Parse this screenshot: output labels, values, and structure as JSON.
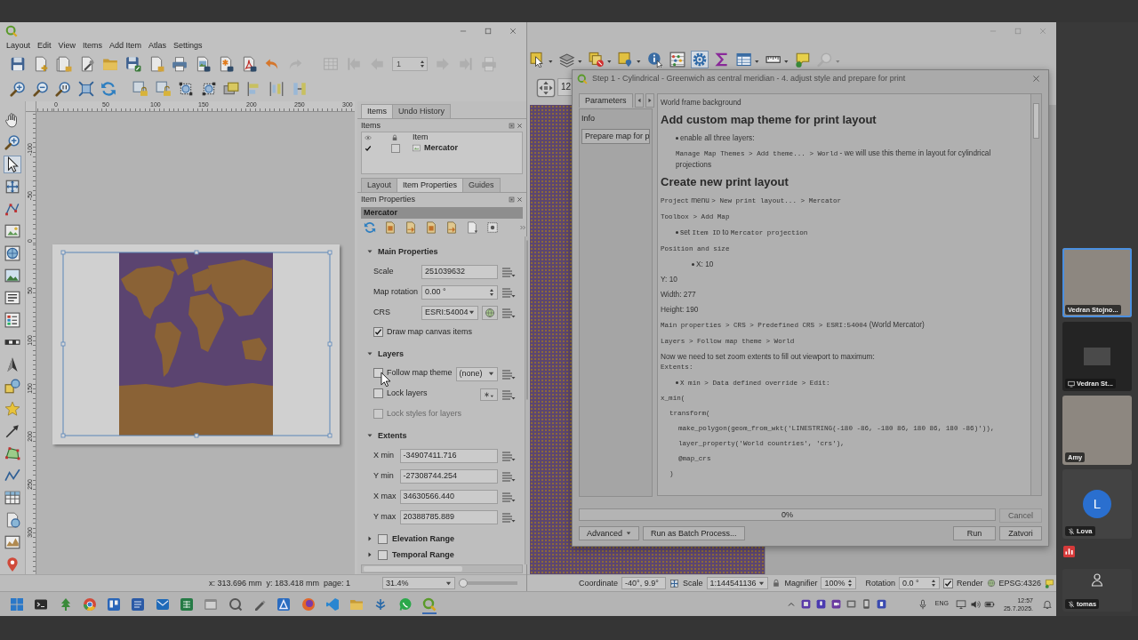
{
  "layout_window": {
    "menu": [
      "Layout",
      "Edit",
      "View",
      "Items",
      "Add Item",
      "Atlas",
      "Settings"
    ],
    "toolbar": [
      {
        "disabled": false
      },
      {
        "disabled": false
      },
      {
        "disabled": false
      },
      {
        "disabled": false
      },
      {
        "disabled": false
      },
      {
        "disabled": false
      },
      {
        "disabled": false
      },
      {
        "disabled": false
      },
      {
        "disabled": false
      },
      {
        "disabled": false
      },
      {
        "disabled": false
      },
      {
        "disabled": false
      },
      {
        "disabled": true
      }
    ],
    "atlas_toolbar": [
      {
        "kind": "button",
        "disabled": true
      },
      {
        "kind": "button",
        "disabled": true
      },
      {
        "kind": "button",
        "disabled": true
      },
      {
        "kind": "field",
        "value": "1",
        "disabled": true
      },
      {
        "kind": "button",
        "disabled": true
      },
      {
        "kind": "button",
        "disabled": true
      },
      {
        "kind": "button",
        "disabled": true
      }
    ],
    "toolbox": [
      {
        "selected": false
      },
      {
        "selected": false
      },
      {
        "selected": true
      },
      {
        "selected": false
      },
      {
        "selected": false
      },
      {
        "selected": false
      },
      {
        "selected": false
      },
      {
        "selected": false
      },
      {
        "selected": false
      },
      {
        "selected": false
      },
      {
        "selected": false
      },
      {
        "selected": false
      },
      {
        "selected": false
      },
      {
        "selected": false
      },
      {
        "selected": false
      },
      {
        "selected": false
      },
      {
        "selected": false
      },
      {
        "selected": false
      },
      {
        "selected": false
      },
      {
        "selected": false
      },
      {
        "selected": false
      }
    ],
    "ruler_labels": [
      "0",
      "50",
      "100",
      "150",
      "200",
      "250",
      "300"
    ],
    "vertical_ruler_labels": [
      "-100",
      "-50",
      "0",
      "50",
      "100",
      "150",
      "200",
      "250",
      "300"
    ],
    "items_dock": {
      "tabs": [
        {
          "label": "Items",
          "selected": true
        },
        {
          "label": "Undo History",
          "selected": false
        }
      ],
      "title": "Items",
      "column": "Item",
      "rows": [
        {
          "label": "Mercator",
          "visible": true,
          "locked": false
        }
      ]
    },
    "properties_dock": {
      "tabs": [
        {
          "label": "Layout",
          "selected": false
        },
        {
          "label": "Item Properties",
          "selected": true
        },
        {
          "label": "Guides",
          "selected": false
        }
      ],
      "title": "Item Properties",
      "item": "Mercator",
      "sections": [
        {
          "title": "Main Properties",
          "expanded": true,
          "rows": [
            {
              "kind": "field",
              "label": "Scale",
              "value": "251039632",
              "disabled": false
            },
            {
              "kind": "spin",
              "label": "Map rotation",
              "value": "0.00 °",
              "disabled": false
            },
            {
              "kind": "combo",
              "label": "CRS",
              "value": "ESRI:54004",
              "disabled": false
            },
            {
              "kind": "check",
              "label": "Draw map canvas items",
              "checked": true,
              "disabled": false
            }
          ]
        },
        {
          "title": "Layers",
          "expanded": true,
          "rows": [
            {
              "kind": "check_combo",
              "label": "Follow map theme",
              "checked": false,
              "value": "(none)",
              "disabled": false
            },
            {
              "kind": "check_button",
              "label": "Lock layers",
              "checked": false,
              "disabled": false
            },
            {
              "kind": "check",
              "label": "Lock styles for layers",
              "checked": false,
              "disabled": true
            }
          ]
        },
        {
          "title": "Extents",
          "expanded": true,
          "rows": [
            {
              "kind": "field",
              "label": "X min",
              "value": "-34907411.716",
              "disabled": false
            },
            {
              "kind": "field",
              "label": "Y min",
              "value": "-27308744.254",
              "disabled": false
            },
            {
              "kind": "field",
              "label": "X max",
              "value": "34630566.440",
              "disabled": false
            },
            {
              "kind": "field",
              "label": "Y max",
              "value": "20388785.889",
              "disabled": false
            }
          ]
        },
        {
          "title": "Elevation Range",
          "expanded": false,
          "checked": false
        },
        {
          "title": "Temporal Range",
          "expanded": false,
          "checked": false
        }
      ]
    },
    "status_bar": {
      "position": "x: 313.696 mm  y: 183.418 mm  page: 1",
      "zoom": "31.4%",
      "zoom_slider": {
        "level": 0.06
      }
    }
  },
  "main_window": {
    "toolbar": [
      {
        "selected": false,
        "disabled": false
      },
      {
        "selected": false,
        "disabled": false
      },
      {
        "selected": false,
        "disabled": false
      },
      {
        "selected": false,
        "disabled": false
      },
      {
        "selected": false,
        "disabled": false
      },
      {
        "selected": false,
        "disabled": false
      },
      {
        "selected": true,
        "disabled": false
      },
      {
        "selected": false,
        "disabled": false
      },
      {
        "selected": false,
        "disabled": false
      },
      {
        "selected": false,
        "disabled": false
      },
      {
        "selected": false,
        "disabled": false
      },
      {
        "selected": false,
        "disabled": true
      }
    ],
    "page_value": "12",
    "status_bar": {
      "coordinate_label": "Coordinate",
      "coordinate": "-40°, 9.9°",
      "scale_label": "Scale",
      "scale": "1:144541136",
      "magnifier_label": "Magnifier",
      "magnifier": "100%",
      "rotation_label": "Rotation",
      "rotation": "0.0 °",
      "render": {
        "label": "Render",
        "checked": true
      },
      "crs": "EPSG:4326"
    }
  },
  "dialog": {
    "title": "Step 1 - Cylindrical - Greenwich as central meridian - 4. adjust style and prepare for print",
    "tabs": [
      {
        "label": "Parameters",
        "selected": true
      }
    ],
    "info_label": "Info",
    "steps": [
      {
        "label": "Prepare map for p",
        "selected": true
      }
    ],
    "content": [
      {
        "kind": "para",
        "parts": [
          {
            "kind": "text",
            "text": "World frame background"
          }
        ]
      },
      {
        "kind": "heading",
        "text": "Add custom map theme for print layout"
      },
      {
        "kind": "bullet",
        "parts": [
          {
            "kind": "text",
            "text": "enable all three layers:"
          }
        ]
      },
      {
        "kind": "indent",
        "parts": [
          {
            "kind": "code",
            "text": "Manage Map Themes > Add theme... > World"
          },
          {
            "kind": "text",
            "text": " - we will use this theme in layout for cylindrical projections"
          }
        ]
      },
      {
        "kind": "heading",
        "text": "Create new print layout"
      },
      {
        "kind": "para",
        "parts": [
          {
            "kind": "code",
            "text": "Project"
          },
          {
            "kind": "text",
            "text": " menu "
          },
          {
            "kind": "code",
            "text": "> New print layout... > Mercator"
          }
        ]
      },
      {
        "kind": "para",
        "parts": [
          {
            "kind": "code",
            "text": "Toolbox > Add Map"
          }
        ]
      },
      {
        "kind": "bullet",
        "parts": [
          {
            "kind": "text",
            "text": "set "
          },
          {
            "kind": "code",
            "text": "Item ID"
          },
          {
            "kind": "text",
            "text": " to "
          },
          {
            "kind": "code",
            "text": "Mercator projection"
          }
        ]
      },
      {
        "kind": "para",
        "parts": [
          {
            "kind": "code",
            "text": "Position and size"
          }
        ]
      },
      {
        "kind": "bullet2",
        "parts": [
          {
            "kind": "text",
            "text": "X: 10"
          }
        ]
      },
      {
        "kind": "para",
        "parts": [
          {
            "kind": "text",
            "text": "Y: 10"
          }
        ]
      },
      {
        "kind": "para",
        "parts": [
          {
            "kind": "text",
            "text": "Width: 277"
          }
        ]
      },
      {
        "kind": "para",
        "parts": [
          {
            "kind": "text",
            "text": "Height: 190"
          }
        ]
      },
      {
        "kind": "para",
        "parts": [
          {
            "kind": "code",
            "text": "Main properties > CRS > Predefined CRS > ESRI:54004"
          },
          {
            "kind": "text",
            "text": " (World Mercator)"
          }
        ]
      },
      {
        "kind": "para",
        "parts": [
          {
            "kind": "code",
            "text": "Layers > Follow map theme > World"
          }
        ]
      },
      {
        "kind": "para",
        "parts": [
          {
            "kind": "text",
            "text": "Now we need to set zoom extents to fill out viewport to maximum:"
          },
          {
            "kind": "code_line",
            "text": "Extents:"
          }
        ]
      },
      {
        "kind": "bullet",
        "parts": [
          {
            "kind": "code",
            "text": "X min > Data defined override > Edit:"
          }
        ]
      },
      {
        "kind": "code",
        "lines": [
          {
            "text": "x_min(",
            "children": [
              {
                "text": "transform(",
                "children": [
                  {
                    "text": "make_polygon(geom_from_wkt('LINESTRING(-180 -86, -180 86, 180 86, 180 -86)')),"
                  },
                  {
                    "text": "layer_property('World countries', 'crs'),"
                  },
                  {
                    "text": "@map_crs"
                  }
                ]
              },
              {
                "text": ")"
              }
            ]
          }
        ]
      }
    ],
    "progress": {
      "level": 0,
      "text": "0%"
    },
    "cancel": {
      "label": "Cancel",
      "disabled": true
    },
    "left_buttons": [
      {
        "label": "Advanced",
        "kind": "menu"
      },
      {
        "label": "Run as Batch Process...",
        "kind": "plain"
      }
    ],
    "right_buttons": [
      {
        "label": "Run"
      },
      {
        "label": "Zatvori"
      }
    ]
  },
  "participants": [
    {
      "name": "Vedran Stojno...",
      "kind": "video",
      "active": true,
      "muted": false,
      "sharing": false
    },
    {
      "name": "Vedran St...",
      "kind": "screen",
      "active": false,
      "muted": false,
      "sharing": true
    },
    {
      "name": "Amy",
      "kind": "video",
      "active": false,
      "muted": false,
      "sharing": false
    },
    {
      "name": "Lova",
      "kind": "avatar",
      "initial": "L",
      "active": false,
      "muted": true,
      "sharing": false
    }
  ],
  "self_view": {
    "name": "tomas",
    "muted": true
  },
  "taskbar": {
    "apps": [
      {
        "active": false
      },
      {
        "active": false
      },
      {
        "active": false
      },
      {
        "active": false
      },
      {
        "active": false
      },
      {
        "active": false
      },
      {
        "active": false
      },
      {
        "active": false
      },
      {
        "active": false
      },
      {
        "active": false
      },
      {
        "active": false
      },
      {
        "active": false
      },
      {
        "active": false
      },
      {
        "active": false
      },
      {
        "active": false
      },
      {
        "active": false
      },
      {
        "active": false
      },
      {
        "active": true
      }
    ],
    "tray": {
      "language": "ENG",
      "time": "12:57",
      "date": "25.7.2025."
    }
  }
}
